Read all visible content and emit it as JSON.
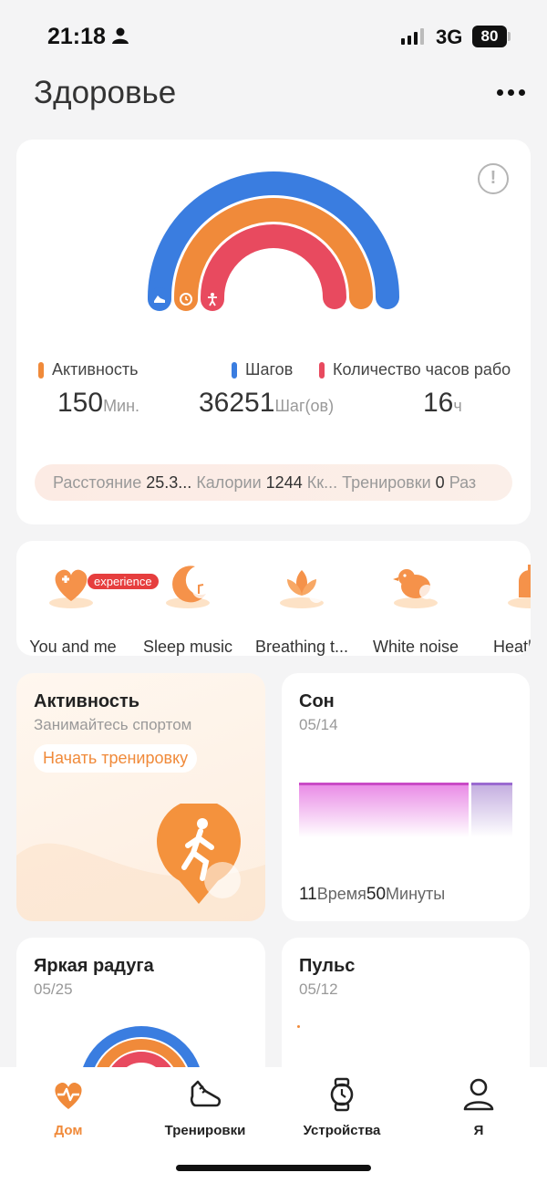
{
  "status_bar": {
    "time": "21:18",
    "network": "3G",
    "battery": "80"
  },
  "header": {
    "title": "Здоровье"
  },
  "rings_card": {
    "legend": [
      {
        "label": "Активность",
        "color": "#f08a3a"
      },
      {
        "label": "Шагов",
        "color": "#3a7de0"
      },
      {
        "label": "Количество часов рабо",
        "color": "#e84a5f"
      }
    ],
    "metrics": [
      {
        "value": "150",
        "unit": "Мин."
      },
      {
        "value": "36251",
        "unit": "Шаг(ов)"
      },
      {
        "value": "16",
        "unit": "ч"
      }
    ],
    "summary": {
      "distance_label": "Расстояние",
      "distance_value": "25.3...",
      "calories_label": "Калории",
      "calories_value": "1244",
      "calories_unit": "Кк...",
      "workouts_label": "Тренировки",
      "workouts_value": "0",
      "workouts_unit": "Раз"
    },
    "ring_colors": {
      "outer": "#3a7de0",
      "middle": "#f08a3a",
      "inner": "#e84a5f"
    }
  },
  "features": [
    {
      "label": "You and me",
      "badge": "experience",
      "icon": "heart-plus-icon"
    },
    {
      "label": "Sleep music",
      "icon": "moon-music-icon"
    },
    {
      "label": "Breathing t...",
      "icon": "lotus-icon"
    },
    {
      "label": "White noise",
      "icon": "bird-icon"
    },
    {
      "label": "Heath",
      "icon": "alarm-icon"
    }
  ],
  "activity_tile": {
    "title": "Активность",
    "subtitle": "Занимайтесь спортом",
    "button": "Начать тренировку"
  },
  "sleep_tile": {
    "title": "Сон",
    "date": "05/14",
    "hours": "11",
    "hours_label": "Время",
    "minutes": "50",
    "minutes_label": "Минуты"
  },
  "rainbow_tile": {
    "title": "Яркая радуга",
    "date": "05/25"
  },
  "pulse_tile": {
    "title": "Пульс",
    "date": "05/12"
  },
  "tabbar": {
    "tabs": [
      {
        "label": "Дом",
        "active": true
      },
      {
        "label": "Тренировки",
        "active": false
      },
      {
        "label": "Устройства",
        "active": false
      },
      {
        "label": "Я",
        "active": false
      }
    ]
  },
  "accent": "#f08a3a"
}
